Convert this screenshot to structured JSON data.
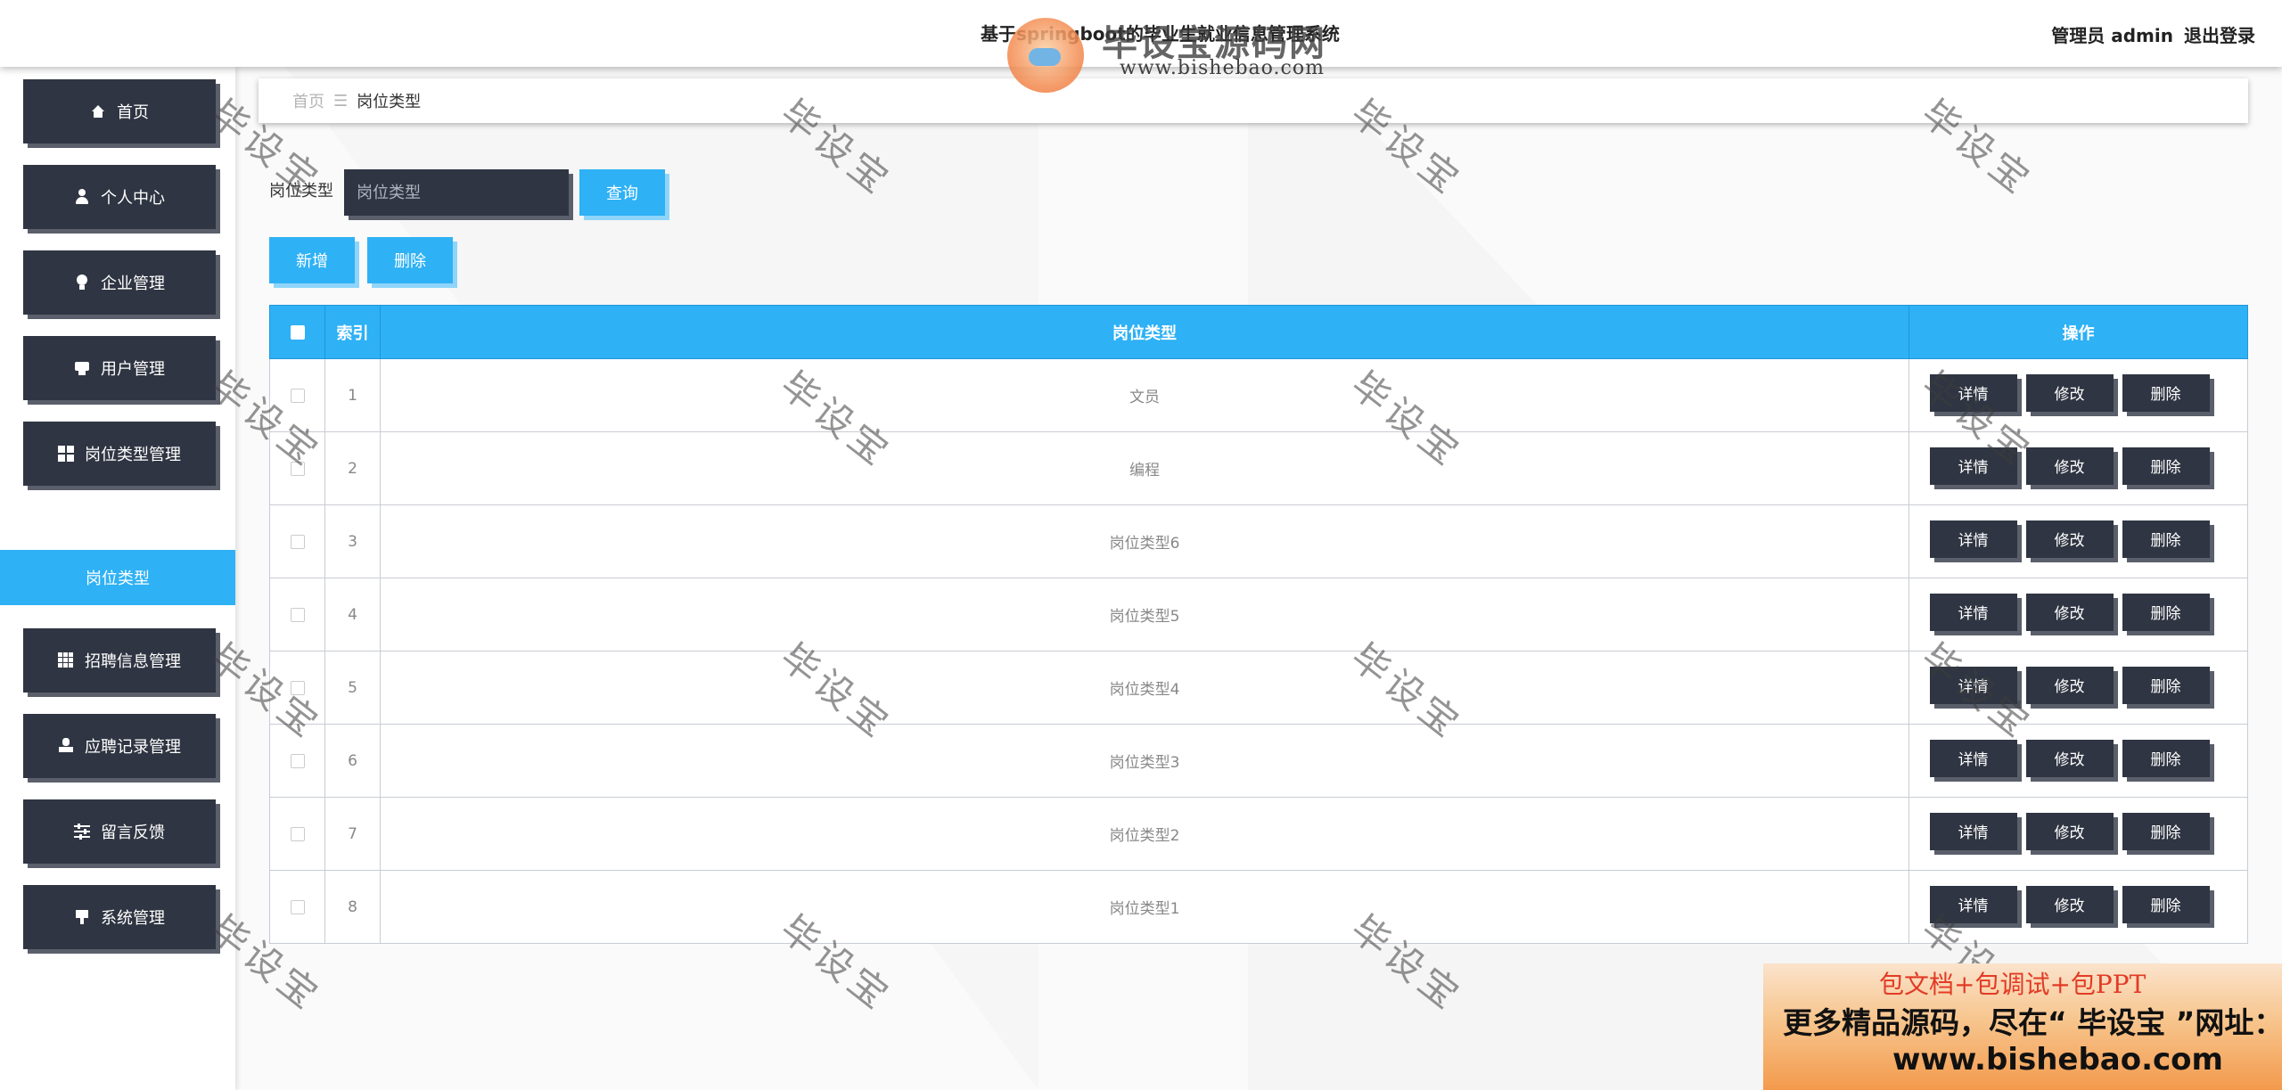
{
  "header": {
    "title": "基于springboot的毕业生就业信息管理系统",
    "user_role": "管理员 admin",
    "logout": "退出登录"
  },
  "brand": {
    "name": "毕设宝源码网",
    "url": "www.bishebao.com"
  },
  "sidebar": {
    "items": [
      {
        "label": "首页",
        "icon": "home-icon"
      },
      {
        "label": "个人中心",
        "icon": "user-icon"
      },
      {
        "label": "企业管理",
        "icon": "bulb-icon"
      },
      {
        "label": "用户管理",
        "icon": "printer-icon"
      },
      {
        "label": "岗位类型管理",
        "icon": "grid-icon"
      },
      {
        "label": "招聘信息管理",
        "icon": "grid9-icon"
      },
      {
        "label": "应聘记录管理",
        "icon": "person-icon"
      },
      {
        "label": "留言反馈",
        "icon": "sliders-icon"
      },
      {
        "label": "系统管理",
        "icon": "signpost-icon"
      }
    ],
    "active_sub": "岗位类型"
  },
  "breadcrumb": {
    "home": "首页",
    "separator": "☰",
    "current": "岗位类型"
  },
  "search": {
    "label": "岗位类型",
    "placeholder": "岗位类型",
    "button": "查询"
  },
  "toolbar": {
    "add": "新增",
    "delete": "删除"
  },
  "table": {
    "columns": [
      "索引",
      "岗位类型",
      "操作"
    ],
    "rows": [
      {
        "index": "1",
        "type": "文员"
      },
      {
        "index": "2",
        "type": "编程"
      },
      {
        "index": "3",
        "type": "岗位类型6"
      },
      {
        "index": "4",
        "type": "岗位类型5"
      },
      {
        "index": "5",
        "type": "岗位类型4"
      },
      {
        "index": "6",
        "type": "岗位类型3"
      },
      {
        "index": "7",
        "type": "岗位类型2"
      },
      {
        "index": "8",
        "type": "岗位类型1"
      }
    ],
    "actions": {
      "detail": "详情",
      "edit": "修改",
      "delete": "删除"
    }
  },
  "watermark": "毕设宝",
  "ad": {
    "line1": "包文档+包调试+包PPT",
    "line2": "更多精品源码，尽在“ 毕设宝 ”网址：",
    "line3": "www.bishebao.com"
  }
}
